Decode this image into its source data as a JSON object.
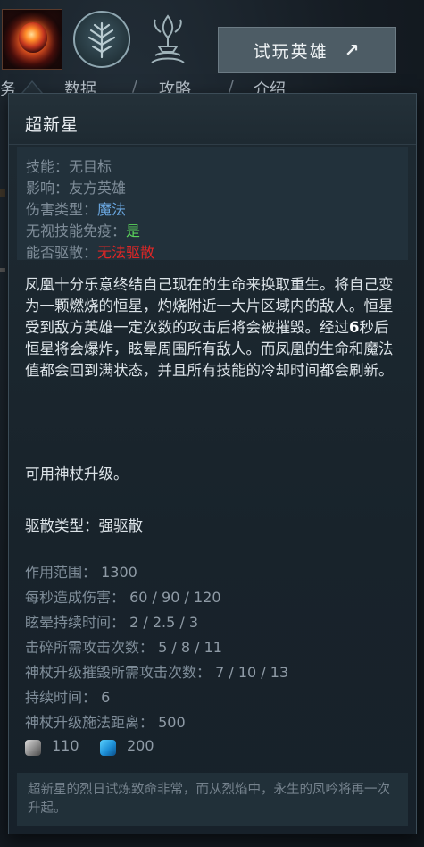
{
  "top_bar": {
    "try_hero_button": {
      "label": "试玩英雄",
      "icon": "arrow-up-right-icon"
    },
    "hero_ability_icons": [
      "supernova-icon",
      "scepter-tree-icon",
      "relic-icon"
    ]
  },
  "nav": {
    "items": [
      {
        "label": "数据"
      },
      {
        "label": "攻略"
      },
      {
        "label": "介绍"
      }
    ],
    "separator": "/",
    "partial_left": "务"
  },
  "tooltip": {
    "title": "超新星",
    "properties": [
      {
        "key": "技能：",
        "value": "无目标",
        "color": "#7f8d99"
      },
      {
        "key": "影响：",
        "value": "友方英雄",
        "color": "#7f8d99"
      },
      {
        "key": "伤害类型：",
        "value": "魔法",
        "color": "#6aa7e0"
      },
      {
        "key": "无视技能免疫：",
        "value": "是",
        "color": "#5bd45b"
      },
      {
        "key": "能否驱散：",
        "value": "无法驱散",
        "color": "#e02626"
      }
    ],
    "description": {
      "part1": "凤凰十分乐意终结自己现在的生命来换取重生。将自己变为一颗燃烧的恒星，灼烧附近一大片区域内的敌人。恒星受到敌方英雄一定次数的攻击后将会被摧毁。经过",
      "highlight": "6",
      "part2": "秒后恒星将会爆炸，眩晕周围所有敌人。而凤凰的生命和魔法值都会回到满状态，并且所有技能的冷却时间都会刷新。"
    },
    "scepter_note": "可用神杖升级。",
    "dispel_type": "驱散类型：强驱散",
    "stats": [
      {
        "label": "作用范围：",
        "value": "1300"
      },
      {
        "label": "每秒造成伤害：",
        "value": "60 / 90 / 120"
      },
      {
        "label": "眩晕持续时间：",
        "value": "2 / 2.5 / 3"
      },
      {
        "label": "击碎所需攻击次数：",
        "value": "5 / 8 / 11"
      },
      {
        "label": "神杖升级摧毁所需攻击次数：",
        "value": "7 / 10 / 13"
      },
      {
        "label": "持续时间：",
        "value": "6"
      },
      {
        "label": "神杖升级施法距离：",
        "value": "500"
      }
    ],
    "cooldown": {
      "icon": "cooldown-icon",
      "value": "110"
    },
    "mana": {
      "icon": "mana-icon",
      "value": "200"
    },
    "lore": "超新星的烈日试炼致命非常，而从烈焰中，永生的凤吟将再一次升起。"
  }
}
